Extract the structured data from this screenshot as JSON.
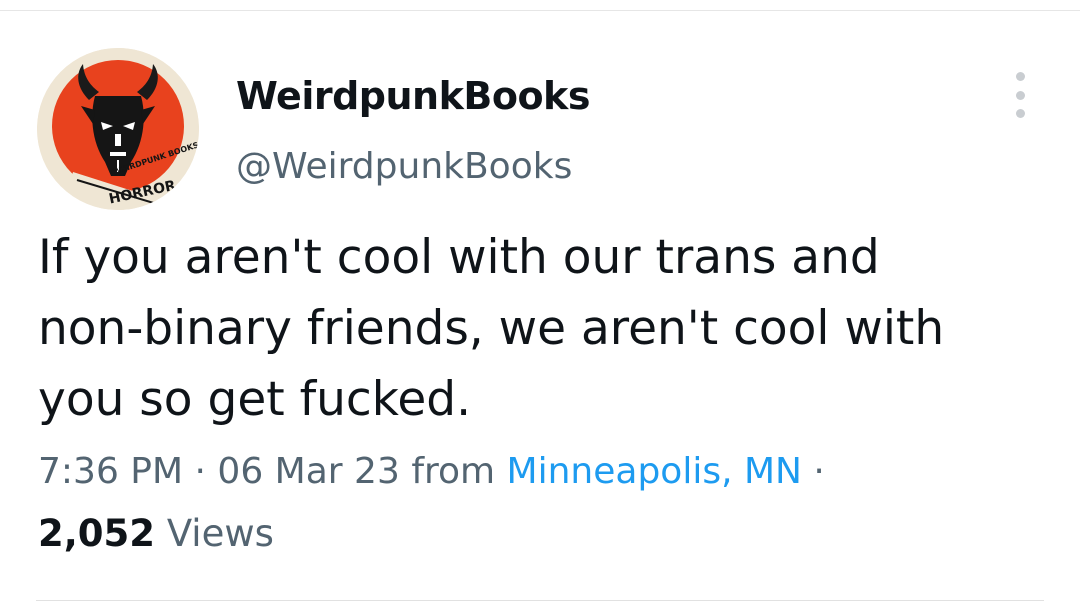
{
  "tweet": {
    "author": {
      "display_name": "WeirdpunkBooks",
      "handle": "@WeirdpunkBooks",
      "avatar": {
        "icon": "devil-head-logo-icon",
        "ring_text": "WEIRDPUNK BOOKS",
        "banner_text": "HORROR"
      }
    },
    "text_lines": [
      "If you aren't cool with our trans and",
      "non-binary friends, we aren't cool with",
      "you so get fucked."
    ],
    "meta": {
      "time": "7:36 PM",
      "separator": "·",
      "date": "06 Mar 23",
      "from_label": "from",
      "location": "Minneapolis, MN",
      "trailing_separator": "·"
    },
    "views": {
      "count": "2,052",
      "label": "Views"
    },
    "more_icon": "more-dots-vertical-icon"
  },
  "colors": {
    "text": "#0f1419",
    "secondary": "#536471",
    "link": "#1d9bf0",
    "avatar_red": "#e8421e",
    "avatar_bg": "#efe6d4"
  }
}
